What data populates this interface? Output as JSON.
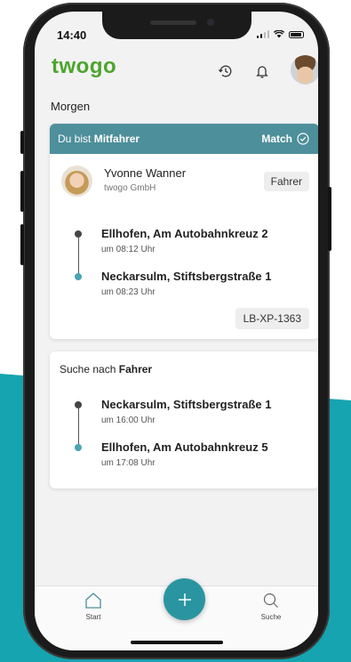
{
  "status_bar": {
    "time": "14:40"
  },
  "header": {
    "logo": "twogo",
    "history_icon": "history-icon",
    "bell_icon": "bell-icon",
    "avatar": "user-avatar"
  },
  "section_title": "Morgen",
  "ride_card": {
    "role_prefix": "Du bist",
    "role_name": "Mitfahrer",
    "match_label": "Match",
    "person": {
      "name": "Yvonne Wanner",
      "company": "twogo GmbH",
      "role": "Fahrer"
    },
    "stops": [
      {
        "name": "Ellhofen, Am Autobahnkreuz 2",
        "time": "um 08:12 Uhr"
      },
      {
        "name": "Neckarsulm, Stiftsbergstraße 1",
        "time": "um 08:23 Uhr"
      }
    ],
    "plate": "LB-XP-1363"
  },
  "search_card": {
    "prefix": "Suche nach",
    "target": "Fahrer",
    "stops": [
      {
        "name": "Neckarsulm, Stiftsbergstraße 1",
        "time": "um 16:00 Uhr"
      },
      {
        "name": "Ellhofen, Am Autobahnkreuz 5",
        "time": "um 17:08 Uhr"
      }
    ]
  },
  "nav": {
    "start": "Start",
    "search": "Suche"
  },
  "colors": {
    "brand_green": "#4ca52c",
    "teal": "#2a95a0",
    "card_header": "#4d8f9b",
    "background_band": "#16a4b0"
  }
}
